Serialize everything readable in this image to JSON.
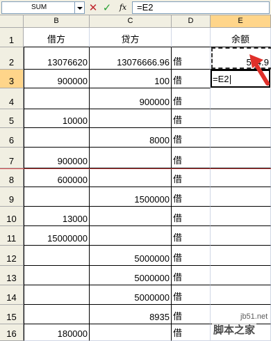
{
  "formula_bar": {
    "name_box": "SUM",
    "cancel_glyph": "✕",
    "enter_glyph": "✓",
    "fx_label": "fx",
    "formula": "=E2"
  },
  "columns": [
    "B",
    "C",
    "D",
    "E"
  ],
  "rows": [
    "1",
    "2",
    "3",
    "4",
    "5",
    "6",
    "7",
    "8",
    "9",
    "10",
    "11",
    "12",
    "13",
    "14",
    "15",
    "16"
  ],
  "cells": {
    "B1": "借方",
    "C1": "贷方",
    "E1": "余额",
    "B2": "13076620",
    "C2": "13076666.96",
    "D2": "借",
    "E2": "554.9",
    "B3": "900000",
    "C3": "100",
    "D3": "借",
    "E3": "=E2",
    "C4": "900000",
    "D4": "借",
    "B5": "10000",
    "D5": "借",
    "C6": "8000",
    "D6": "借",
    "B7": "900000",
    "D7": "借",
    "B8": "600000",
    "D8": "借",
    "C9": "1500000",
    "D9": "借",
    "B10": "13000",
    "D10": "借",
    "B11": "15000000",
    "D11": "借",
    "C12": "5000000",
    "D12": "借",
    "C13": "5000000",
    "D13": "借",
    "C14": "5000000",
    "D14": "借",
    "C15": "8935",
    "D15": "借",
    "B16": "180000",
    "D16": "借"
  },
  "watermark": {
    "line1": "jb51.net",
    "line2": "脚本之家"
  },
  "colors": {
    "header_bg": "#f1efe2",
    "active_header": "#ffd58a",
    "gridline": "#d0d7e5",
    "page_break": "#e05050",
    "arrow": "#e0302a"
  },
  "icons": {
    "cancel": "cancel-x-icon",
    "enter": "enter-check-icon",
    "insert_function": "fx-icon",
    "dropdown": "chevron-down-icon",
    "annotation": "red-arrow-icon"
  }
}
